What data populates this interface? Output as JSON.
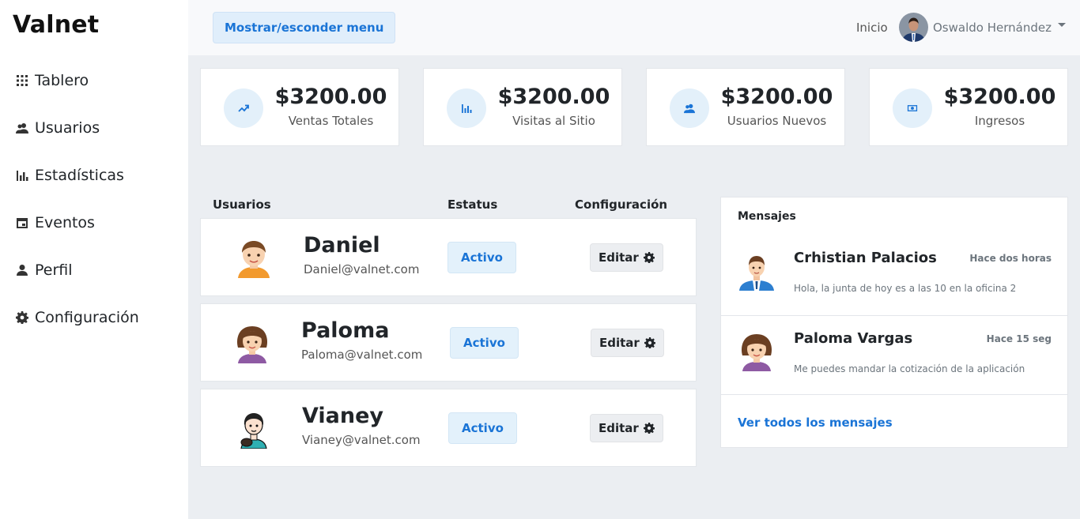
{
  "brand": "Valnet",
  "sidebar": {
    "items": [
      {
        "label": "Tablero",
        "icon": "grid-icon"
      },
      {
        "label": "Usuarios",
        "icon": "users-icon"
      },
      {
        "label": "Estadísticas",
        "icon": "bar-chart-icon"
      },
      {
        "label": "Eventos",
        "icon": "calendar-icon"
      },
      {
        "label": "Perfil",
        "icon": "person-icon"
      },
      {
        "label": "Configuración",
        "icon": "gear-icon"
      }
    ]
  },
  "topbar": {
    "toggle_label": "Mostrar/esconder menu",
    "home_label": "Inicio",
    "user_name": "Oswaldo Hernández"
  },
  "stats": [
    {
      "value": "$3200.00",
      "label": "Ventas Totales",
      "icon": "trending-up-icon"
    },
    {
      "value": "$3200.00",
      "label": "Visitas al Sitio",
      "icon": "bar-chart-icon"
    },
    {
      "value": "$3200.00",
      "label": "Usuarios Nuevos",
      "icon": "users-icon"
    },
    {
      "value": "$3200.00",
      "label": "Ingresos",
      "icon": "money-icon"
    }
  ],
  "users_table": {
    "headers": {
      "users": "Usuarios",
      "status": "Estatus",
      "config": "Configuración"
    },
    "rows": [
      {
        "name": "Daniel",
        "email": "Daniel@valnet.com",
        "status": "Activo",
        "action": "Editar"
      },
      {
        "name": "Paloma",
        "email": "Paloma@valnet.com",
        "status": "Activo",
        "action": "Editar"
      },
      {
        "name": "Vianey",
        "email": "Vianey@valnet.com",
        "status": "Activo",
        "action": "Editar"
      }
    ]
  },
  "messages": {
    "title": "Mensajes",
    "items": [
      {
        "name": "Crhistian Palacios",
        "time": "Hace dos horas",
        "text": "Hola, la junta de hoy es a las 10 en la oficina 2"
      },
      {
        "name": "Paloma Vargas",
        "time": "Hace 15 seg",
        "text": "Me puedes mandar la cotización de la aplicación"
      }
    ],
    "view_all": "Ver todos los mensajes"
  },
  "colors": {
    "accent": "#1a74d6",
    "badge_bg": "#e3f1fb",
    "page_bg": "#ebeef2"
  }
}
